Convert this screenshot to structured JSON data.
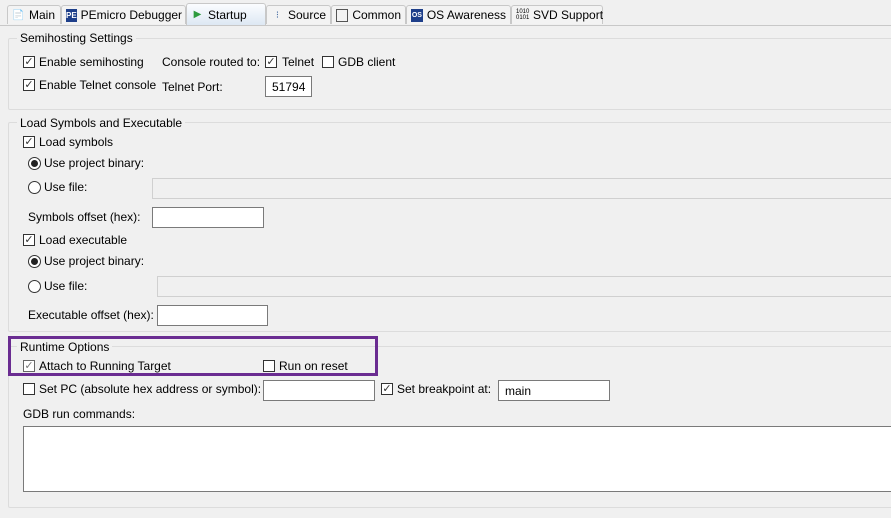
{
  "tabs": [
    {
      "label": "Main",
      "icon": "document-icon"
    },
    {
      "label": "PEmicro Debugger",
      "icon": "pemicro-icon"
    },
    {
      "label": "Startup",
      "icon": "play-icon",
      "selected": true
    },
    {
      "label": "Source",
      "icon": "source-icon"
    },
    {
      "label": "Common",
      "icon": "common-icon"
    },
    {
      "label": "OS Awareness",
      "icon": "os-icon"
    },
    {
      "label": "SVD Support",
      "icon": "binary-icon"
    }
  ],
  "semihosting": {
    "title": "Semihosting Settings",
    "enable_semihosting": "Enable semihosting",
    "enable_telnet": "Enable Telnet console",
    "console_routed": "Console routed to:",
    "telnet": "Telnet",
    "gdb_client": "GDB client",
    "telnet_port_label": "Telnet Port:",
    "telnet_port": "51794"
  },
  "load": {
    "title": "Load Symbols and Executable",
    "load_symbols": "Load symbols",
    "use_project_binary": "Use project binary:",
    "use_file": "Use file:",
    "symbols_offset": "Symbols offset (hex):",
    "load_executable": "Load executable",
    "executable_offset": "Executable offset (hex):"
  },
  "runtime": {
    "title": "Runtime Options",
    "attach": "Attach to Running Target",
    "run_on_reset": "Run on reset",
    "set_pc": "Set PC (absolute hex address or symbol):",
    "set_breakpoint": "Set breakpoint at:",
    "breakpoint_value": "main",
    "gdb_run_commands": "GDB run commands:"
  },
  "colors": {
    "highlight": "#6a2c91"
  }
}
